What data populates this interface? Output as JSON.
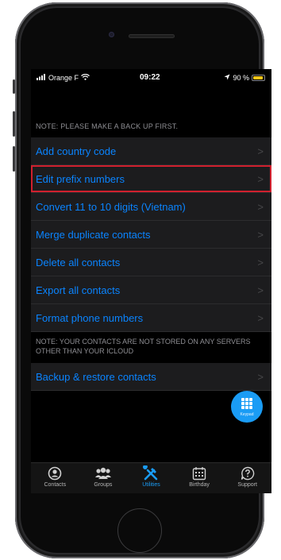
{
  "status_bar": {
    "carrier": "Orange F",
    "time": "09:22",
    "battery_percent": "90 %",
    "battery_level": 0.9
  },
  "note_top": "NOTE: PLEASE MAKE A BACK UP FIRST.",
  "menu_items": [
    {
      "label": "Add country code"
    },
    {
      "label": "Edit prefix numbers",
      "highlighted": true
    },
    {
      "label": "Convert 11 to 10 digits (Vietnam)"
    },
    {
      "label": "Merge duplicate contacts"
    },
    {
      "label": "Delete all contacts"
    },
    {
      "label": "Export all contacts"
    },
    {
      "label": "Format phone numbers"
    }
  ],
  "note_bottom": "NOTE: YOUR CONTACTS ARE NOT STORED ON ANY SERVERS OTHER THAN YOUR ICLOUD",
  "backup_item": {
    "label": "Backup & restore contacts"
  },
  "fab": {
    "label": "Keypad",
    "icon": "keypad-grid-icon"
  },
  "tabs": [
    {
      "label": "Contacts",
      "icon": "person-circle-icon"
    },
    {
      "label": "Groups",
      "icon": "group-people-icon"
    },
    {
      "label": "Utilities",
      "icon": "tools-icon",
      "active": true
    },
    {
      "label": "Birthday",
      "icon": "calendar-icon"
    },
    {
      "label": "Support",
      "icon": "question-bubble-icon"
    }
  ],
  "colors": {
    "accent": "#0a84ff",
    "tab_active": "#1a9cf5",
    "highlight_border": "#d0202e",
    "battery": "#f5c518"
  }
}
